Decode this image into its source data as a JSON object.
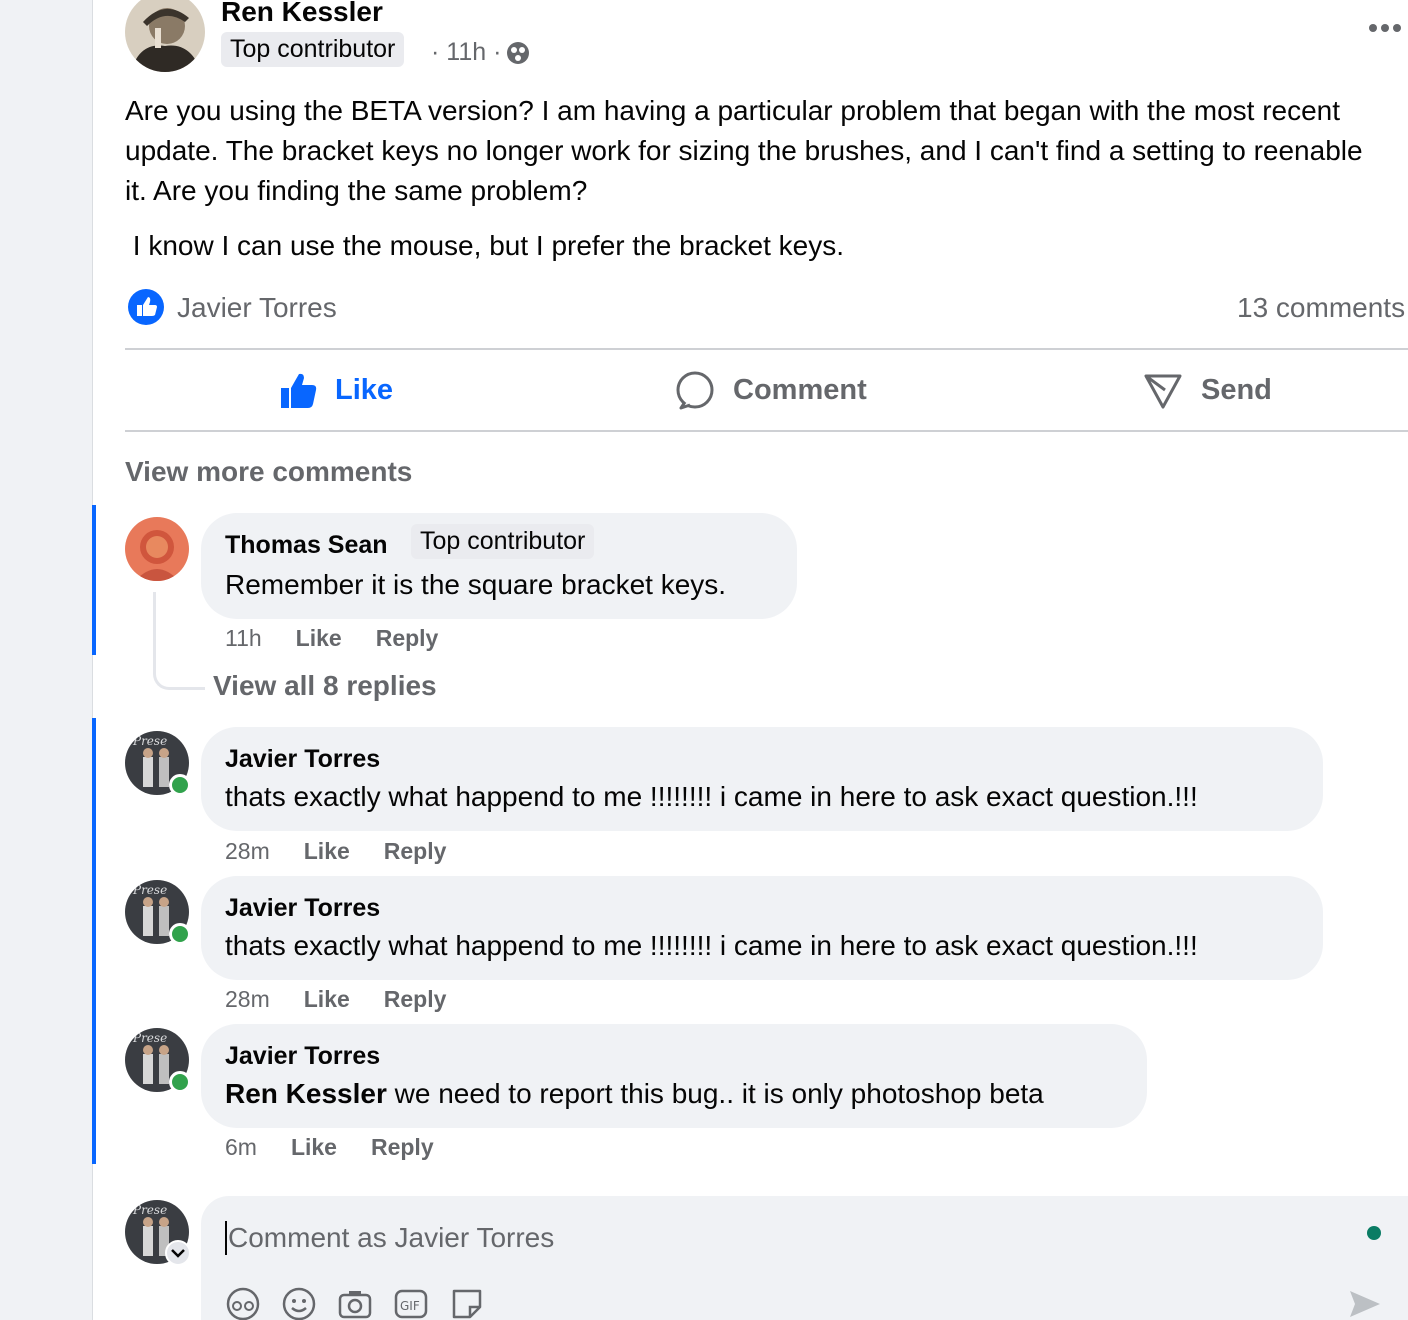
{
  "post": {
    "author": "Ren Kessler",
    "badge": "Top contributor",
    "time": "· 11h ·",
    "more_icon": "more-horizontal-icon",
    "privacy_icon": "globe-icon",
    "paragraph1": "Are you using the BETA version?  I am having a particular problem that began with the most recent update.  The bracket keys no longer work for sizing the brushes, and I can't find a setting to reenable it. Are you finding the same problem?",
    "paragraph2": " I know I can use the mouse, but I prefer the bracket keys."
  },
  "reactions": {
    "reactor": "Javier Torres",
    "comment_count": "13 comments",
    "icon": "like-reaction-icon"
  },
  "actions": {
    "like": "Like",
    "comment": "Comment",
    "send": "Send"
  },
  "comments": {
    "view_more": "View more comments",
    "items": [
      {
        "author": "Thomas Sean",
        "badge": "Top contributor",
        "text": "Remember it is the square bracket keys.",
        "time": "11h",
        "like": "Like",
        "reply": "Reply",
        "view_replies": "View all 8 replies"
      },
      {
        "author": "Javier Torres",
        "text": "thats exactly what happend to me !!!!!!!! i came in here to ask exact question.!!!",
        "time": "28m",
        "like": "Like",
        "reply": "Reply"
      },
      {
        "author": "Javier Torres",
        "text": "thats exactly what happend to me !!!!!!!! i came in here to ask exact question.!!!",
        "time": "28m",
        "like": "Like",
        "reply": "Reply"
      },
      {
        "author": "Javier Torres",
        "mention": "Ren Kessler",
        "text": " we need to report this bug.. it is only photoshop beta",
        "time": "6m",
        "like": "Like",
        "reply": "Reply"
      }
    ]
  },
  "composer": {
    "placeholder": "Comment as Javier Torres",
    "icons": [
      "avatar-sticker-icon",
      "emoji-icon",
      "camera-icon",
      "gif-icon",
      "sticker-icon",
      "send-icon"
    ]
  },
  "colors": {
    "accent": "#0866ff",
    "online": "#31a24c",
    "muted": "#65676b"
  }
}
